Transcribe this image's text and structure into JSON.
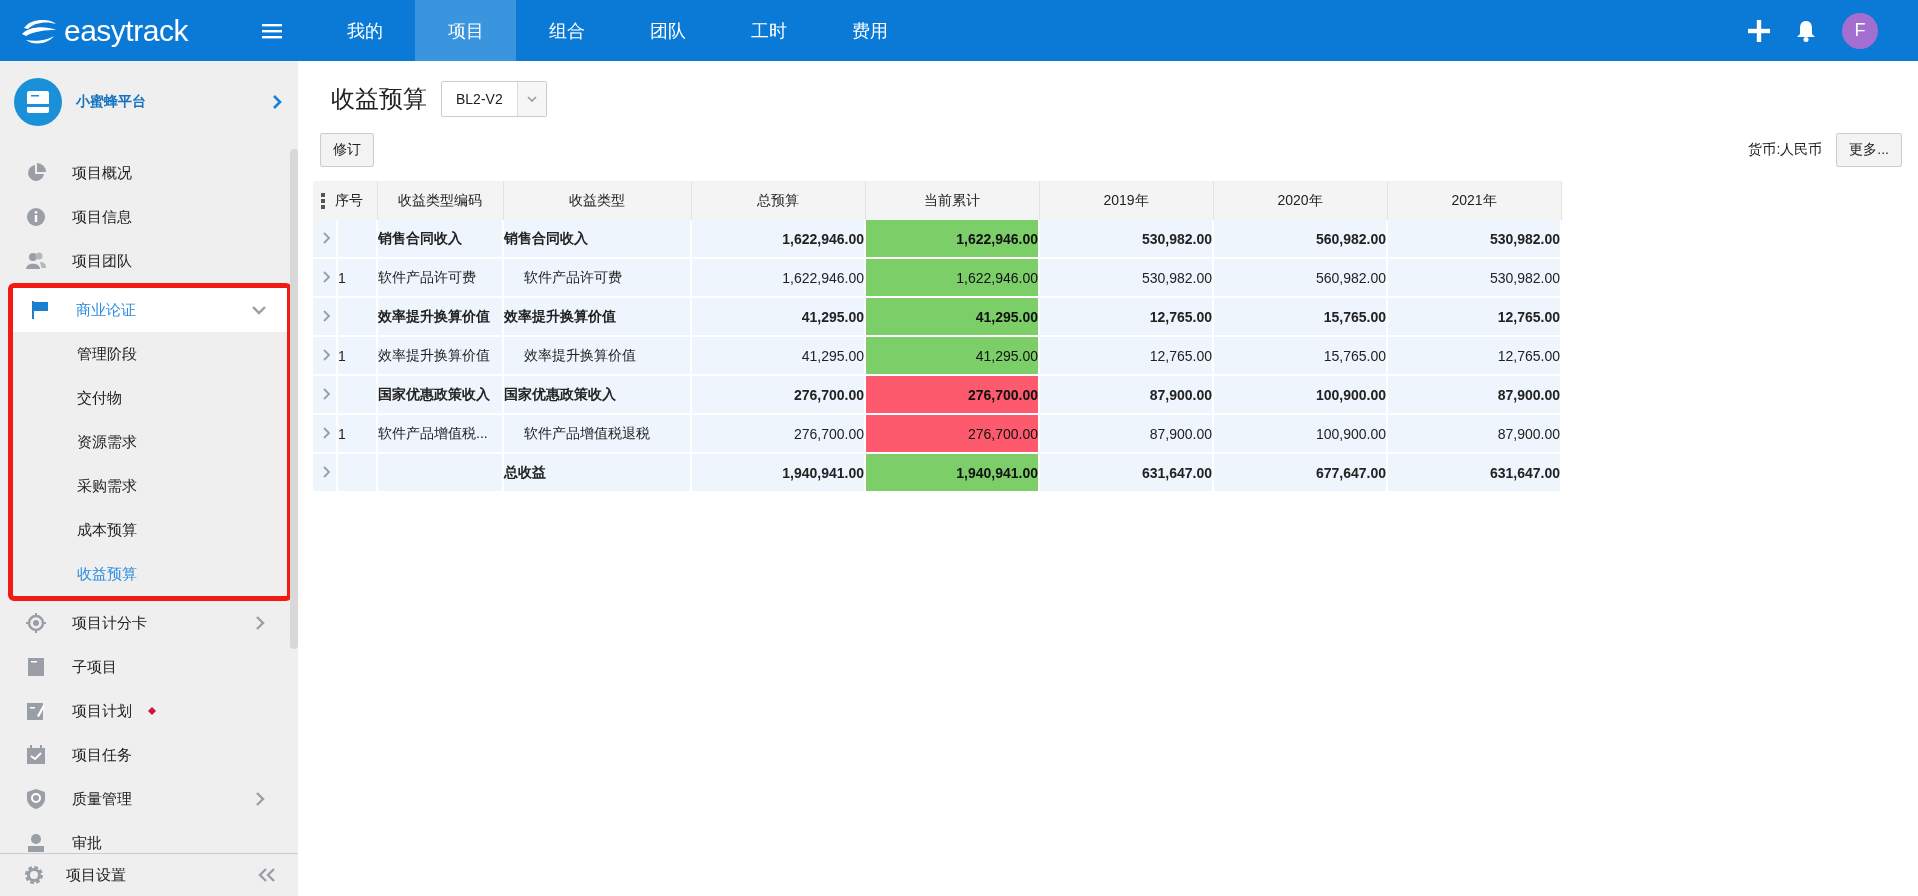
{
  "header": {
    "logo": "easytrack",
    "tabs": [
      {
        "label": "我的",
        "selected": false
      },
      {
        "label": "项目",
        "selected": true
      },
      {
        "label": "组合",
        "selected": false
      },
      {
        "label": "团队",
        "selected": false
      },
      {
        "label": "工时",
        "selected": false
      },
      {
        "label": "费用",
        "selected": false
      }
    ],
    "avatar": "F"
  },
  "sidebar": {
    "project": "小蜜蜂平台",
    "items": [
      {
        "label": "项目概况",
        "selected": false,
        "marked": false
      },
      {
        "label": "项目信息",
        "selected": false,
        "marked": false
      },
      {
        "label": "项目团队",
        "selected": false,
        "marked": false
      },
      {
        "label": "商业论证",
        "selected": true,
        "marked": false,
        "highlighted": true,
        "expanded": true,
        "children": [
          {
            "label": "管理阶段",
            "selected": false
          },
          {
            "label": "交付物",
            "selected": false
          },
          {
            "label": "资源需求",
            "selected": false
          },
          {
            "label": "采购需求",
            "selected": false
          },
          {
            "label": "成本预算",
            "selected": false
          },
          {
            "label": "收益预算",
            "selected": true
          }
        ]
      },
      {
        "label": "项目计分卡",
        "selected": false,
        "marked": false,
        "expanded": false
      },
      {
        "label": "子项目",
        "selected": false,
        "marked": false
      },
      {
        "label": "项目计划",
        "selected": false,
        "marked": true
      },
      {
        "label": "项目任务",
        "selected": false,
        "marked": false
      },
      {
        "label": "质量管理",
        "selected": false,
        "marked": false,
        "expanded": false
      },
      {
        "label": "审批",
        "selected": false,
        "marked": false
      }
    ],
    "settings": "项目设置"
  },
  "page": {
    "title": "收益预算",
    "version": "BL2-V2",
    "revise_button": "修订",
    "currency": "货币:人民币",
    "more_button": "更多..."
  },
  "table": {
    "columns": [
      "序号",
      "收益类型编码",
      "收益类型",
      "总预算",
      "当前累计",
      "2019年",
      "2020年",
      "2021年"
    ],
    "rows": [
      {
        "kind": "group",
        "code": "销售合同收入",
        "type": "销售合同收入",
        "total": "1,622,946.00",
        "current": "1,622,946.00",
        "color": "#7ccf68",
        "years": [
          "530,982.00",
          "560,982.00",
          "530,982.00"
        ]
      },
      {
        "kind": "detail",
        "seq": "1",
        "code": "软件产品许可费",
        "type": "软件产品许可费",
        "total": "1,622,946.00",
        "current": "1,622,946.00",
        "color": "#7ccf68",
        "years": [
          "530,982.00",
          "560,982.00",
          "530,982.00"
        ]
      },
      {
        "kind": "group",
        "code": "效率提升换算价值",
        "type": "效率提升换算价值",
        "total": "41,295.00",
        "current": "41,295.00",
        "color": "#7ccf68",
        "years": [
          "12,765.00",
          "15,765.00",
          "12,765.00"
        ]
      },
      {
        "kind": "detail",
        "seq": "1",
        "code": "效率提升换算价值",
        "type": "效率提升换算价值",
        "total": "41,295.00",
        "current": "41,295.00",
        "color": "#7ccf68",
        "years": [
          "12,765.00",
          "15,765.00",
          "12,765.00"
        ]
      },
      {
        "kind": "group",
        "code": "国家优惠政策收入",
        "type": "国家优惠政策收入",
        "total": "276,700.00",
        "current": "276,700.00",
        "color": "#fd5a6e",
        "years": [
          "87,900.00",
          "100,900.00",
          "87,900.00"
        ]
      },
      {
        "kind": "detail",
        "seq": "1",
        "code": "软件产品增值税...",
        "type": "软件产品增值税退税",
        "total": "276,700.00",
        "current": "276,700.00",
        "color": "#fd5a6e",
        "years": [
          "87,900.00",
          "100,900.00",
          "87,900.00"
        ]
      },
      {
        "kind": "total",
        "type": "总收益",
        "total": "1,940,941.00",
        "current": "1,940,941.00",
        "color": "#7ccf68",
        "years": [
          "631,647.00",
          "677,647.00",
          "631,647.00"
        ]
      }
    ]
  }
}
